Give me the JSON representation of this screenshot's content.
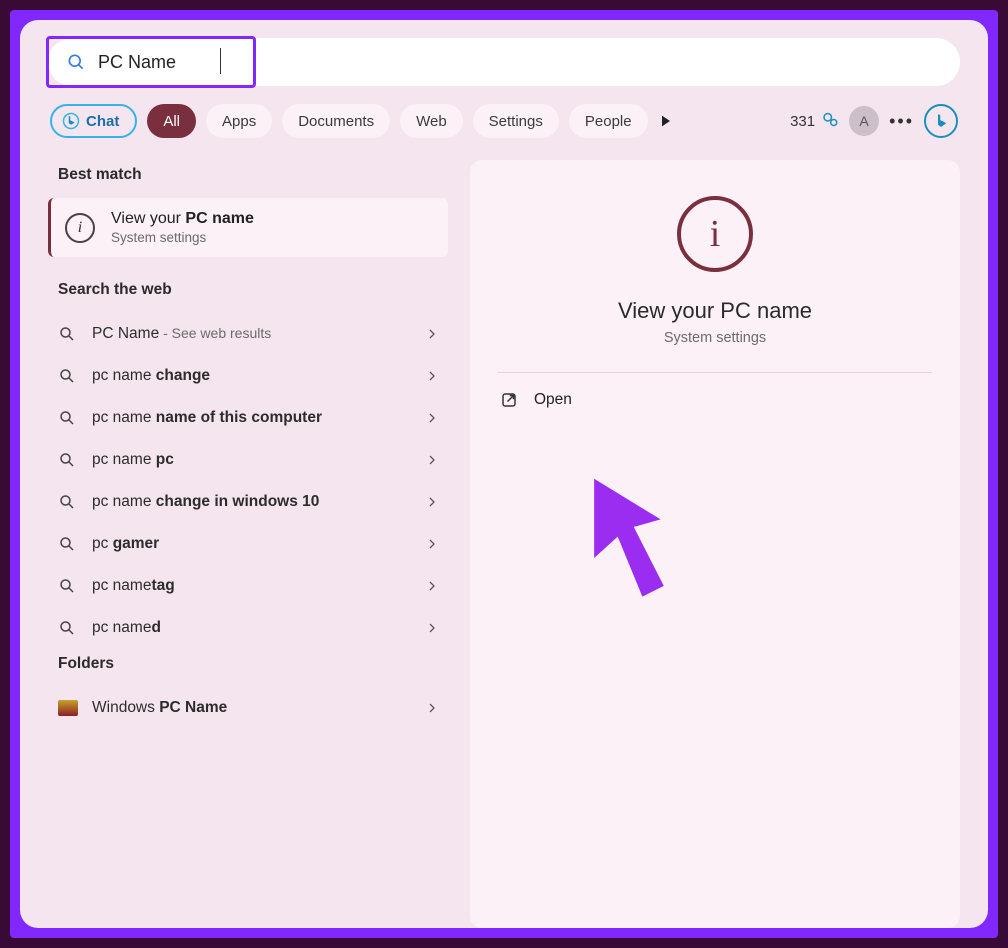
{
  "search": {
    "query": "PC Name"
  },
  "filters": {
    "chat": "Chat",
    "all": "All",
    "apps": "Apps",
    "documents": "Documents",
    "web": "Web",
    "settings": "Settings",
    "people": "People"
  },
  "header": {
    "reward_points": "331",
    "avatar_initial": "A"
  },
  "left": {
    "best_match_head": "Best match",
    "best_match": {
      "prefix": "View your ",
      "bold": "PC name",
      "subtitle": "System settings"
    },
    "web_head": "Search the web",
    "web_results": [
      {
        "plain": "PC Name",
        "suffix": " - See web results"
      },
      {
        "plain": "pc name ",
        "bold": "change"
      },
      {
        "plain": "pc name ",
        "bold": "name of this computer"
      },
      {
        "plain": "pc name ",
        "bold": "pc"
      },
      {
        "plain": "pc name ",
        "bold": "change in windows 10"
      },
      {
        "plain": "pc ",
        "bold": "gamer"
      },
      {
        "plain": "pc name",
        "bold": "tag"
      },
      {
        "plain": "pc name",
        "bold": "d"
      }
    ],
    "folders_head": "Folders",
    "folders": [
      {
        "plain": "Windows ",
        "bold": "PC Name"
      }
    ]
  },
  "right": {
    "title": "View your PC name",
    "subtitle": "System settings",
    "open_label": "Open"
  },
  "colors": {
    "accent_purple": "#8127ff",
    "pill_dark": "#7a2f3e",
    "window_bg": "#f5e5ee",
    "panel_bg": "#fbf1f7"
  }
}
